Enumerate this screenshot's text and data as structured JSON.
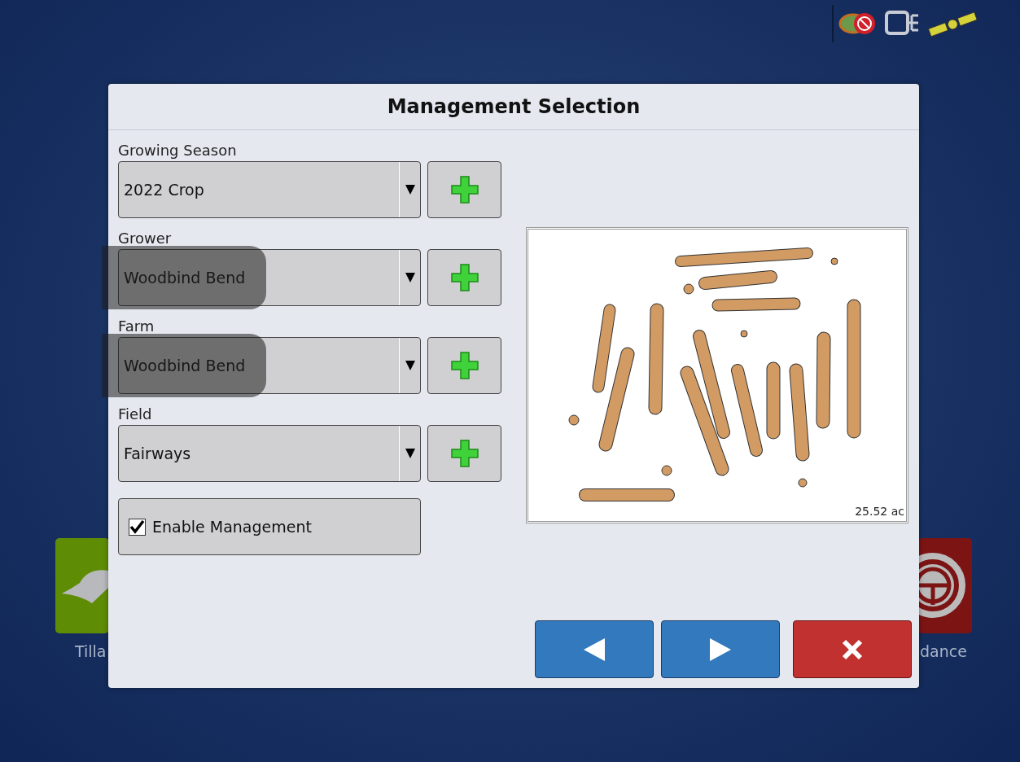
{
  "background_apps": [
    {
      "label": "Tilla",
      "color": "#5f8c05"
    },
    {
      "label": "dance",
      "color": "#7d1414"
    }
  ],
  "dialog": {
    "title": "Management Selection",
    "fields": [
      {
        "label": "Growing Season",
        "value": "2022 Crop",
        "redacted": false
      },
      {
        "label": "Grower",
        "value": "Woodbind Bend",
        "redacted": true
      },
      {
        "label": "Farm",
        "value": "Woodbind Bend",
        "redacted": true
      },
      {
        "label": "Field",
        "value": "Fairways",
        "redacted": false
      }
    ],
    "enable_management": {
      "label": "Enable Management",
      "checked": true
    },
    "map": {
      "area": "25.52 ac"
    },
    "buttons": [
      {
        "kind": "back"
      },
      {
        "kind": "next"
      },
      {
        "kind": "cancel"
      }
    ]
  }
}
